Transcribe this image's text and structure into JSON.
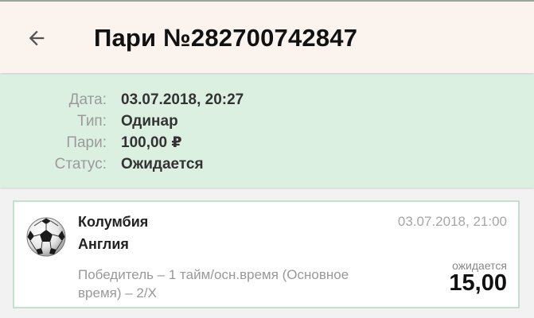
{
  "header": {
    "title": "Пари №282700742847",
    "back_icon": "arrow-left-icon"
  },
  "info": {
    "rows": [
      {
        "label": "Дата:",
        "value": "03.07.2018, 20:27"
      },
      {
        "label": "Тип:",
        "value": "Одинар"
      },
      {
        "label": "Пари:",
        "value": "100,00 ₽"
      },
      {
        "label": "Статус:",
        "value": "Ожидается"
      }
    ]
  },
  "event": {
    "sport_icon": "soccer-ball-icon",
    "team1": "Колумбия",
    "team2": "Англия",
    "date": "03.07.2018, 21:00",
    "market": "Победитель – 1 тайм/осн.время (Основное время) – 2/Х",
    "status": "ожидается",
    "odds": "15,00"
  },
  "colors": {
    "header_bg": "#faf3ee",
    "info_bg": "#dcf0e2",
    "card_border": "#bfe3c9",
    "page_bg": "#f2f2f2"
  }
}
